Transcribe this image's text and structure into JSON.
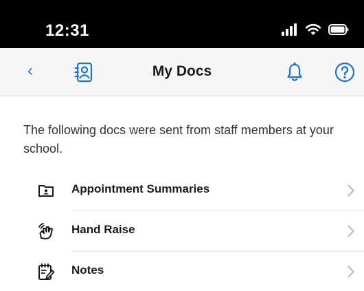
{
  "status_bar": {
    "time": "12:31"
  },
  "nav": {
    "back": "‹",
    "title": "My Docs"
  },
  "intro": "The following docs were sent from staff members at your school.",
  "list": {
    "items": [
      {
        "label": "Appointment Summaries",
        "icon": "appointment-summary-icon"
      },
      {
        "label": "Hand Raise",
        "icon": "hand-raise-icon"
      },
      {
        "label": "Notes",
        "icon": "notes-icon"
      }
    ]
  },
  "colors": {
    "accent": "#1a73e8",
    "nav_background": "#f7f7f7",
    "status_bar": "#000000",
    "chevron": "#b5b5b5"
  }
}
